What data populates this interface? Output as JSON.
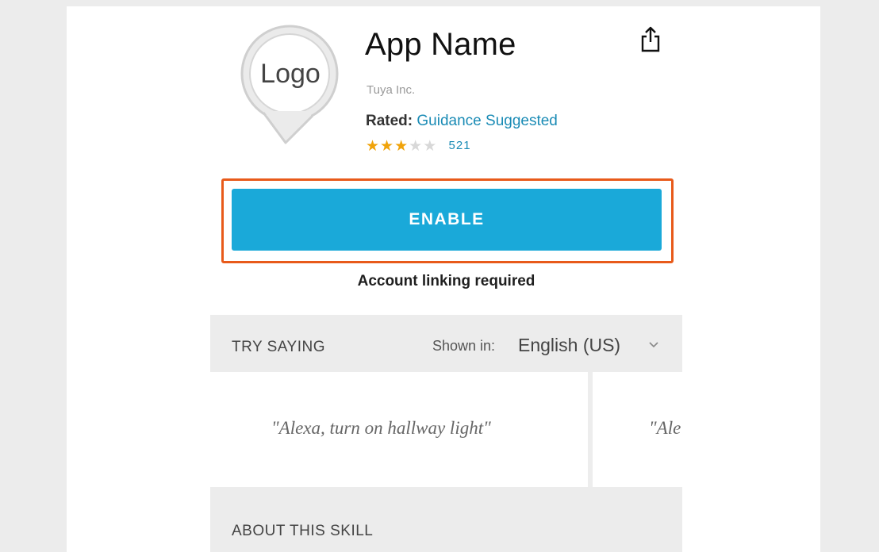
{
  "app": {
    "logo_text": "Logo",
    "name": "App Name",
    "developer": "Tuya Inc."
  },
  "rating": {
    "rated_label": "Rated:",
    "rated_value": "Guidance Suggested",
    "stars": 3,
    "max_stars": 5,
    "review_count": "521"
  },
  "enable_button": {
    "label": "ENABLE"
  },
  "account_note": "Account linking required",
  "try_saying": {
    "title": "TRY SAYING",
    "shown_in_label": "Shown in:",
    "language": "English (US)",
    "phrases": [
      "\"Alexa, turn on hallway light\"",
      "\"Ale"
    ]
  },
  "about": {
    "title": "ABOUT THIS SKILL"
  },
  "colors": {
    "accent": "#1aa9d9",
    "highlight": "#e85a1a",
    "star_on": "#f0a30a",
    "star_off": "#d8d8d8",
    "link": "#1a8bb5"
  },
  "icons": {
    "share": "share-icon",
    "chevron": "chevron-down-icon"
  }
}
